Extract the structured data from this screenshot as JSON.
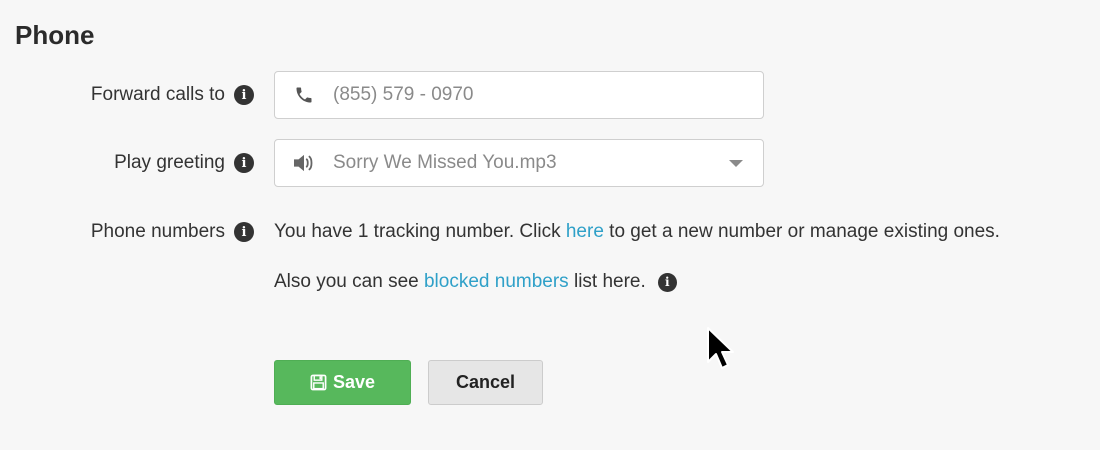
{
  "section": {
    "title": "Phone"
  },
  "forward_calls": {
    "label": "Forward calls to",
    "placeholder": "(855) 579 - 0970",
    "icon": "phone-icon"
  },
  "play_greeting": {
    "label": "Play greeting",
    "selected": "Sorry We Missed You.mp3",
    "icon": "speaker-icon"
  },
  "phone_numbers": {
    "label": "Phone numbers",
    "line1_before": "You have 1 tracking number. Click",
    "line1_link": "here",
    "line1_after": "to get a new number or manage existing ones.",
    "line2_before": "Also you can see",
    "line2_link": "blocked numbers",
    "line2_after": "list here."
  },
  "buttons": {
    "save_label": "Save",
    "cancel_label": "Cancel"
  },
  "colors": {
    "link": "#2fa0c8",
    "save": "#57b85c",
    "cancel": "#e6e6e6",
    "background": "#f7f7f7"
  }
}
